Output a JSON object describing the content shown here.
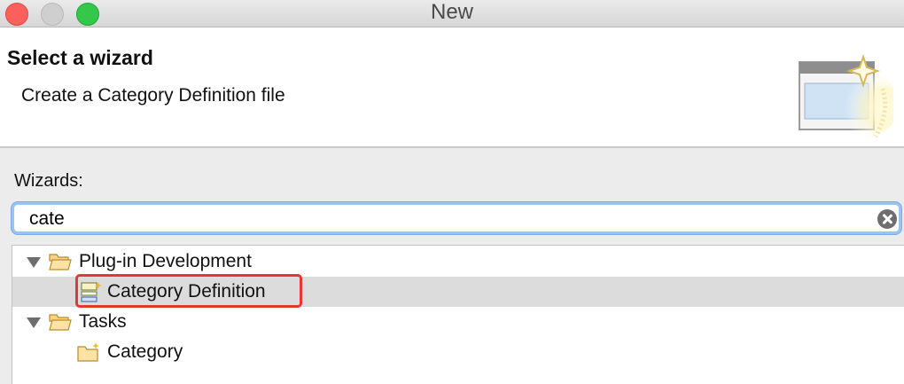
{
  "window": {
    "title": "New"
  },
  "banner": {
    "title": "Select a wizard",
    "description": "Create a Category Definition file"
  },
  "wizards": {
    "label": "Wizards:",
    "filter_value": "cate",
    "tree": [
      {
        "label": "Plug-in Development",
        "expanded": true,
        "children": [
          {
            "label": "Category Definition",
            "selected": true
          }
        ]
      },
      {
        "label": "Tasks",
        "expanded": true,
        "children": [
          {
            "label": "Category",
            "selected": false
          }
        ]
      }
    ]
  },
  "colors": {
    "selection_row": "#dcdcdc",
    "highlight_border": "#e3392f",
    "focus_ring": "#9cc3f0"
  }
}
